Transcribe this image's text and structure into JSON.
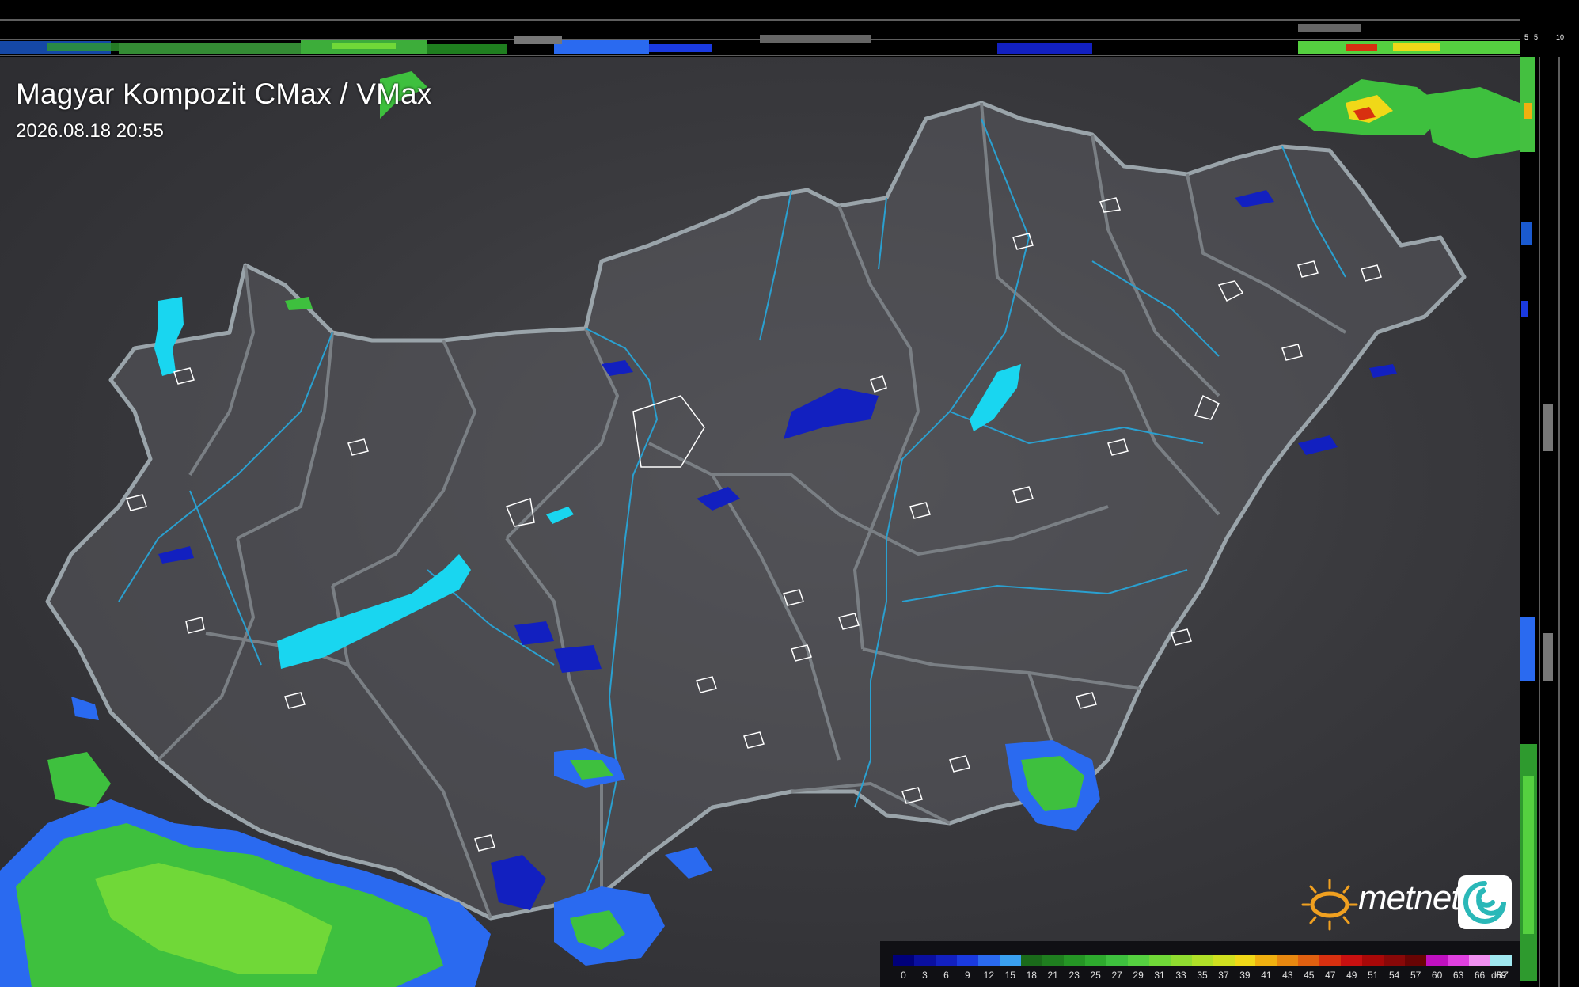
{
  "header": {
    "title": "Magyar Kompozit CMax / VMax",
    "timestamp": "2026.08.18 20:55"
  },
  "profile_scale": {
    "top_labels": [
      "10",
      "5"
    ],
    "right_labels": [
      "5",
      "10"
    ]
  },
  "legend": {
    "unit": "dBZ",
    "labels": [
      "0",
      "3",
      "6",
      "9",
      "12",
      "15",
      "18",
      "21",
      "23",
      "25",
      "27",
      "29",
      "31",
      "33",
      "35",
      "37",
      "39",
      "41",
      "43",
      "45",
      "47",
      "49",
      "51",
      "54",
      "57",
      "60",
      "63",
      "66",
      "69"
    ],
    "colors": [
      "#00007a",
      "#0a0fa0",
      "#1220c0",
      "#1a3ae0",
      "#2a6af0",
      "#3aa0f0",
      "#1a6a1a",
      "#1f7e1f",
      "#259525",
      "#2eaa2e",
      "#3ec03e",
      "#55d040",
      "#70d838",
      "#90dc30",
      "#b0e028",
      "#d0e020",
      "#f0d818",
      "#f0b010",
      "#e88810",
      "#e06010",
      "#d83010",
      "#c81010",
      "#a80808",
      "#880808",
      "#680404",
      "#c010c0",
      "#e040e0",
      "#f090f0",
      "#a0e8f0"
    ]
  },
  "logo": {
    "brand": "metnet"
  },
  "colors": {
    "country_border": "#9aa4aa",
    "county_border": "#7a7f84",
    "rivers": "#2aa0d0",
    "lakes": "#19d6f0",
    "settlements": "#ffffff"
  }
}
